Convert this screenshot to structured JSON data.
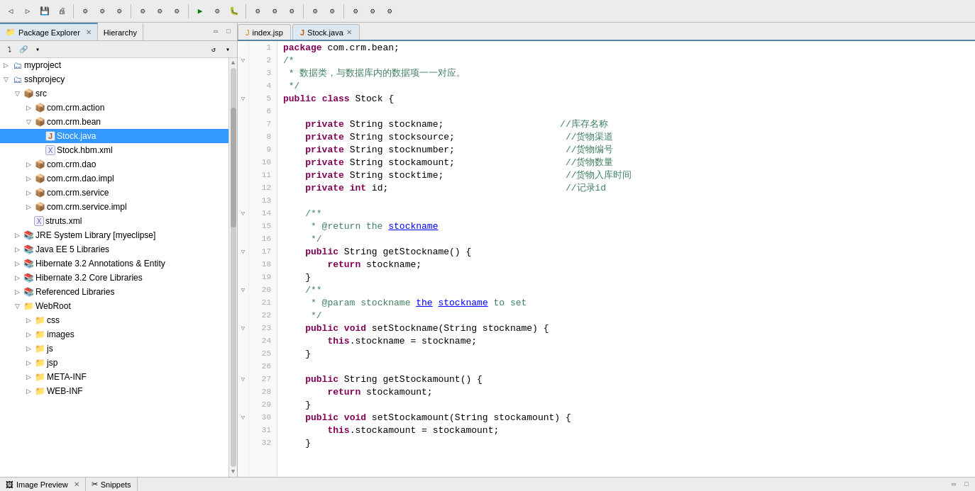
{
  "toolbar": {
    "buttons": [
      "⬅",
      "▶",
      "💾",
      "📋",
      "🔍",
      "🔧",
      "▶",
      "⏹",
      "🐛",
      "📦"
    ]
  },
  "leftPanel": {
    "tabs": [
      {
        "id": "package-explorer",
        "label": "Package Explorer",
        "active": true
      },
      {
        "id": "hierarchy",
        "label": "Hierarchy",
        "active": false
      }
    ],
    "tree": [
      {
        "id": "myproject",
        "label": "myproject",
        "indent": 0,
        "type": "project",
        "toggle": "▷",
        "icon": "🗂"
      },
      {
        "id": "sshprojecy",
        "label": "sshprojecy",
        "indent": 0,
        "type": "project",
        "toggle": "▽",
        "icon": "🗂"
      },
      {
        "id": "src",
        "label": "src",
        "indent": 1,
        "type": "src",
        "toggle": "▽",
        "icon": "📁"
      },
      {
        "id": "com.crm.action",
        "label": "com.crm.action",
        "indent": 2,
        "type": "package",
        "toggle": "▷",
        "icon": "📦"
      },
      {
        "id": "com.crm.bean",
        "label": "com.crm.bean",
        "indent": 2,
        "type": "package",
        "toggle": "▽",
        "icon": "📦"
      },
      {
        "id": "Stock.java",
        "label": "Stock.java",
        "indent": 3,
        "type": "java",
        "toggle": "",
        "icon": "J",
        "selected": true
      },
      {
        "id": "Stock.hbm.xml",
        "label": "Stock.hbm.xml",
        "indent": 3,
        "type": "xml",
        "toggle": "",
        "icon": "X"
      },
      {
        "id": "com.crm.dao",
        "label": "com.crm.dao",
        "indent": 2,
        "type": "package",
        "toggle": "▷",
        "icon": "📦"
      },
      {
        "id": "com.crm.dao.impl",
        "label": "com.crm.dao.impl",
        "indent": 2,
        "type": "package",
        "toggle": "▷",
        "icon": "📦"
      },
      {
        "id": "com.crm.service",
        "label": "com.crm.service",
        "indent": 2,
        "type": "package",
        "toggle": "▷",
        "icon": "📦"
      },
      {
        "id": "com.crm.service.impl",
        "label": "com.crm.service.impl",
        "indent": 2,
        "type": "package",
        "toggle": "▷",
        "icon": "📦"
      },
      {
        "id": "struts.xml",
        "label": "struts.xml",
        "indent": 2,
        "type": "xml",
        "toggle": "",
        "icon": "X"
      },
      {
        "id": "jre-system-library",
        "label": "JRE System Library [myeclipse]",
        "indent": 1,
        "type": "lib",
        "toggle": "▷",
        "icon": "📚"
      },
      {
        "id": "java-ee-5",
        "label": "Java EE 5 Libraries",
        "indent": 1,
        "type": "lib",
        "toggle": "▷",
        "icon": "📚"
      },
      {
        "id": "hibernate-annotations",
        "label": "Hibernate 3.2 Annotations & Entity",
        "indent": 1,
        "type": "lib",
        "toggle": "▷",
        "icon": "📚"
      },
      {
        "id": "hibernate-core",
        "label": "Hibernate 3.2 Core Libraries",
        "indent": 1,
        "type": "lib",
        "toggle": "▷",
        "icon": "📚"
      },
      {
        "id": "referenced-libraries",
        "label": "Referenced Libraries",
        "indent": 1,
        "type": "lib",
        "toggle": "▷",
        "icon": "📚"
      },
      {
        "id": "webroot",
        "label": "WebRoot",
        "indent": 1,
        "type": "folder",
        "toggle": "▽",
        "icon": "📁"
      },
      {
        "id": "css",
        "label": "css",
        "indent": 2,
        "type": "folder",
        "toggle": "▷",
        "icon": "📁"
      },
      {
        "id": "images",
        "label": "images",
        "indent": 2,
        "type": "folder",
        "toggle": "▷",
        "icon": "📁"
      },
      {
        "id": "js",
        "label": "js",
        "indent": 2,
        "type": "folder",
        "toggle": "▷",
        "icon": "📁"
      },
      {
        "id": "jsp",
        "label": "jsp",
        "indent": 2,
        "type": "folder",
        "toggle": "▷",
        "icon": "📁"
      },
      {
        "id": "META-INF",
        "label": "META-INF",
        "indent": 2,
        "type": "folder",
        "toggle": "▷",
        "icon": "📁"
      },
      {
        "id": "WEB-INF",
        "label": "WEB-INF",
        "indent": 2,
        "type": "folder",
        "toggle": "▷",
        "icon": "📁"
      }
    ]
  },
  "editorTabs": [
    {
      "id": "index.jsp",
      "label": "index.jsp",
      "active": false,
      "closable": false
    },
    {
      "id": "Stock.java",
      "label": "Stock.java",
      "active": true,
      "closable": true
    }
  ],
  "codeLines": [
    {
      "num": 1,
      "fold": "",
      "text": "package com.crm.bean;",
      "tokens": [
        {
          "t": "kw",
          "v": "package"
        },
        {
          "t": "ln",
          "v": " com.crm.bean;"
        }
      ]
    },
    {
      "num": 2,
      "fold": "▽",
      "text": "/*",
      "tokens": [
        {
          "t": "cm",
          "v": "/*"
        }
      ]
    },
    {
      "num": 3,
      "fold": "",
      "text": " * 数据类，与数据库内的数据项一一对应。",
      "tokens": [
        {
          "t": "cm",
          "v": " * 数据类，与数据库内的数据项一一对应。"
        }
      ]
    },
    {
      "num": 4,
      "fold": "",
      "text": " */",
      "tokens": [
        {
          "t": "cm",
          "v": " */"
        }
      ]
    },
    {
      "num": 5,
      "fold": "▽",
      "text": "public class Stock {",
      "tokens": [
        {
          "t": "kw",
          "v": "public"
        },
        {
          "t": "ln",
          "v": " "
        },
        {
          "t": "kw",
          "v": "class"
        },
        {
          "t": "ln",
          "v": " Stock {"
        }
      ]
    },
    {
      "num": 6,
      "fold": "",
      "text": "",
      "tokens": []
    },
    {
      "num": 7,
      "fold": "",
      "text": "    private String stockname;                     //库存名称",
      "tokens": [
        {
          "t": "kw",
          "v": "    private"
        },
        {
          "t": "ln",
          "v": " String stockname;                     "
        },
        {
          "t": "cm",
          "v": "//库存名称"
        }
      ]
    },
    {
      "num": 8,
      "fold": "",
      "text": "    private String stocksource;                    //货物渠道",
      "tokens": [
        {
          "t": "kw",
          "v": "    private"
        },
        {
          "t": "ln",
          "v": " String stocksource;                    "
        },
        {
          "t": "cm",
          "v": "//货物渠道"
        }
      ]
    },
    {
      "num": 9,
      "fold": "",
      "text": "    private String stocknumber;                    //货物编号",
      "tokens": [
        {
          "t": "kw",
          "v": "    private"
        },
        {
          "t": "ln",
          "v": " String stocknumber;                    "
        },
        {
          "t": "cm",
          "v": "//货物编号"
        }
      ]
    },
    {
      "num": 10,
      "fold": "",
      "text": "    private String stockamount;                    //货物数量",
      "tokens": [
        {
          "t": "kw",
          "v": "    private"
        },
        {
          "t": "ln",
          "v": " String stockamount;                    "
        },
        {
          "t": "cm",
          "v": "//货物数量"
        }
      ]
    },
    {
      "num": 11,
      "fold": "",
      "text": "    private String stocktime;                      //货物入库时间",
      "tokens": [
        {
          "t": "kw",
          "v": "    private"
        },
        {
          "t": "ln",
          "v": " String stocktime;                      "
        },
        {
          "t": "cm",
          "v": "//货物入库时间"
        }
      ]
    },
    {
      "num": 12,
      "fold": "",
      "text": "    private int id;                                //记录id",
      "tokens": [
        {
          "t": "kw",
          "v": "    private"
        },
        {
          "t": "ln",
          "v": " "
        },
        {
          "t": "kw",
          "v": "int"
        },
        {
          "t": "ln",
          "v": " id;                                "
        },
        {
          "t": "cm",
          "v": "//记录id"
        }
      ]
    },
    {
      "num": 13,
      "fold": "",
      "text": "",
      "tokens": []
    },
    {
      "num": 14,
      "fold": "▽",
      "text": "    /**",
      "tokens": [
        {
          "t": "cm",
          "v": "    /**"
        }
      ]
    },
    {
      "num": 15,
      "fold": "",
      "text": "     * @return the stockname",
      "tokens": [
        {
          "t": "cm",
          "v": "     * "
        },
        {
          "t": "cm",
          "v": "@return"
        },
        {
          "t": "cm",
          "v": " the "
        },
        {
          "t": "ref",
          "v": "stockname"
        }
      ]
    },
    {
      "num": 16,
      "fold": "",
      "text": "     */",
      "tokens": [
        {
          "t": "cm",
          "v": "     */"
        }
      ]
    },
    {
      "num": 17,
      "fold": "▽",
      "text": "    public String getStockname() {",
      "tokens": [
        {
          "t": "kw",
          "v": "    public"
        },
        {
          "t": "ln",
          "v": " String getStockname() {"
        }
      ]
    },
    {
      "num": 18,
      "fold": "",
      "text": "        return stockname;",
      "tokens": [
        {
          "t": "kw",
          "v": "        return"
        },
        {
          "t": "ln",
          "v": " stockname;"
        }
      ]
    },
    {
      "num": 19,
      "fold": "",
      "text": "    }",
      "tokens": [
        {
          "t": "ln",
          "v": "    }"
        }
      ]
    },
    {
      "num": 20,
      "fold": "▽",
      "text": "    /**",
      "tokens": [
        {
          "t": "cm",
          "v": "    /**"
        }
      ]
    },
    {
      "num": 21,
      "fold": "",
      "text": "     * @param stockname the stockname to set",
      "tokens": [
        {
          "t": "cm",
          "v": "     * "
        },
        {
          "t": "cm",
          "v": "@param"
        },
        {
          "t": "cm",
          "v": " stockname "
        },
        {
          "t": "ref",
          "v": "the"
        },
        {
          "t": "cm",
          "v": " "
        },
        {
          "t": "ref",
          "v": "stockname"
        },
        {
          "t": "cm",
          "v": " to set"
        }
      ]
    },
    {
      "num": 22,
      "fold": "",
      "text": "     */",
      "tokens": [
        {
          "t": "cm",
          "v": "     */"
        }
      ]
    },
    {
      "num": 23,
      "fold": "▽",
      "text": "    public void setStockname(String stockname) {",
      "tokens": [
        {
          "t": "kw",
          "v": "    public"
        },
        {
          "t": "ln",
          "v": " "
        },
        {
          "t": "kw",
          "v": "void"
        },
        {
          "t": "ln",
          "v": " setStockname(String stockname) {"
        }
      ]
    },
    {
      "num": 24,
      "fold": "",
      "text": "        this.stockname = stockname;",
      "tokens": [
        {
          "t": "kw",
          "v": "        this"
        },
        {
          "t": "ln",
          "v": ".stockname = stockname;"
        }
      ]
    },
    {
      "num": 25,
      "fold": "",
      "text": "    }",
      "tokens": [
        {
          "t": "ln",
          "v": "    }"
        }
      ]
    },
    {
      "num": 26,
      "fold": "",
      "text": "",
      "tokens": []
    },
    {
      "num": 27,
      "fold": "▽",
      "text": "    public String getStockamount() {",
      "tokens": [
        {
          "t": "kw",
          "v": "    public"
        },
        {
          "t": "ln",
          "v": " String getStockamount() {"
        }
      ]
    },
    {
      "num": 28,
      "fold": "",
      "text": "        return stockamount;",
      "tokens": [
        {
          "t": "kw",
          "v": "        return"
        },
        {
          "t": "ln",
          "v": " stockamount;"
        }
      ]
    },
    {
      "num": 29,
      "fold": "",
      "text": "    }",
      "tokens": [
        {
          "t": "ln",
          "v": "    }"
        }
      ]
    },
    {
      "num": 30,
      "fold": "▽",
      "text": "    public void setStockamount(String stockamount) {",
      "tokens": [
        {
          "t": "kw",
          "v": "    public"
        },
        {
          "t": "ln",
          "v": " "
        },
        {
          "t": "kw",
          "v": "void"
        },
        {
          "t": "ln",
          "v": " setStockamount(String stockamount) {"
        }
      ]
    },
    {
      "num": 31,
      "fold": "",
      "text": "        this.stockamount = stockamount;",
      "tokens": [
        {
          "t": "kw",
          "v": "        this"
        },
        {
          "t": "ln",
          "v": ".stockamount = stockamount;"
        }
      ]
    },
    {
      "num": 32,
      "fold": "",
      "text": "    }",
      "tokens": [
        {
          "t": "ln",
          "v": "    }"
        }
      ]
    }
  ],
  "bottomTabs": [
    {
      "id": "image-preview",
      "label": "Image Preview",
      "active": false
    },
    {
      "id": "snippets",
      "label": "Snippets",
      "active": false
    }
  ]
}
